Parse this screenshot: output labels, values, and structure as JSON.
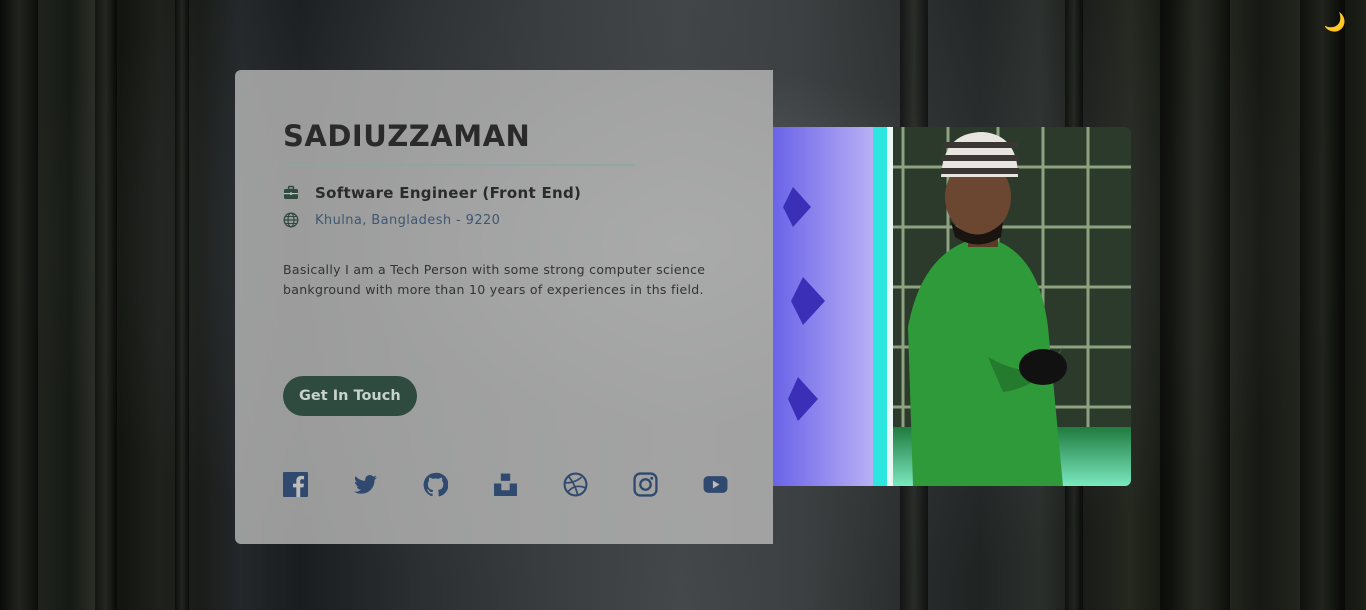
{
  "theme_toggle": {
    "icon": "moon-icon",
    "glyph": "🌙"
  },
  "profile": {
    "name": "SADIUZZAMAN",
    "job_title": "Software Engineer (Front End)",
    "location": "Khulna, Bangladesh - 9220",
    "bio": "Basically I am a Tech Person with some strong computer science bankground with more than 10 years of experiences in ths field.",
    "cta_label": "Get In Touch",
    "photo_alt": "profile photo"
  },
  "social_links": [
    {
      "name": "facebook",
      "icon": "facebook-icon"
    },
    {
      "name": "twitter",
      "icon": "twitter-icon"
    },
    {
      "name": "github",
      "icon": "github-icon"
    },
    {
      "name": "unsplash",
      "icon": "unsplash-icon"
    },
    {
      "name": "dribbble",
      "icon": "dribbble-icon"
    },
    {
      "name": "instagram",
      "icon": "instagram-icon"
    },
    {
      "name": "youtube",
      "icon": "youtube-icon"
    }
  ],
  "colors": {
    "accent_button": "#2f4a3f",
    "icon_color": "#2f4a6e",
    "location_text": "#3f5773",
    "divider": "#8aa6a2",
    "card_bg": "#bebebc"
  }
}
